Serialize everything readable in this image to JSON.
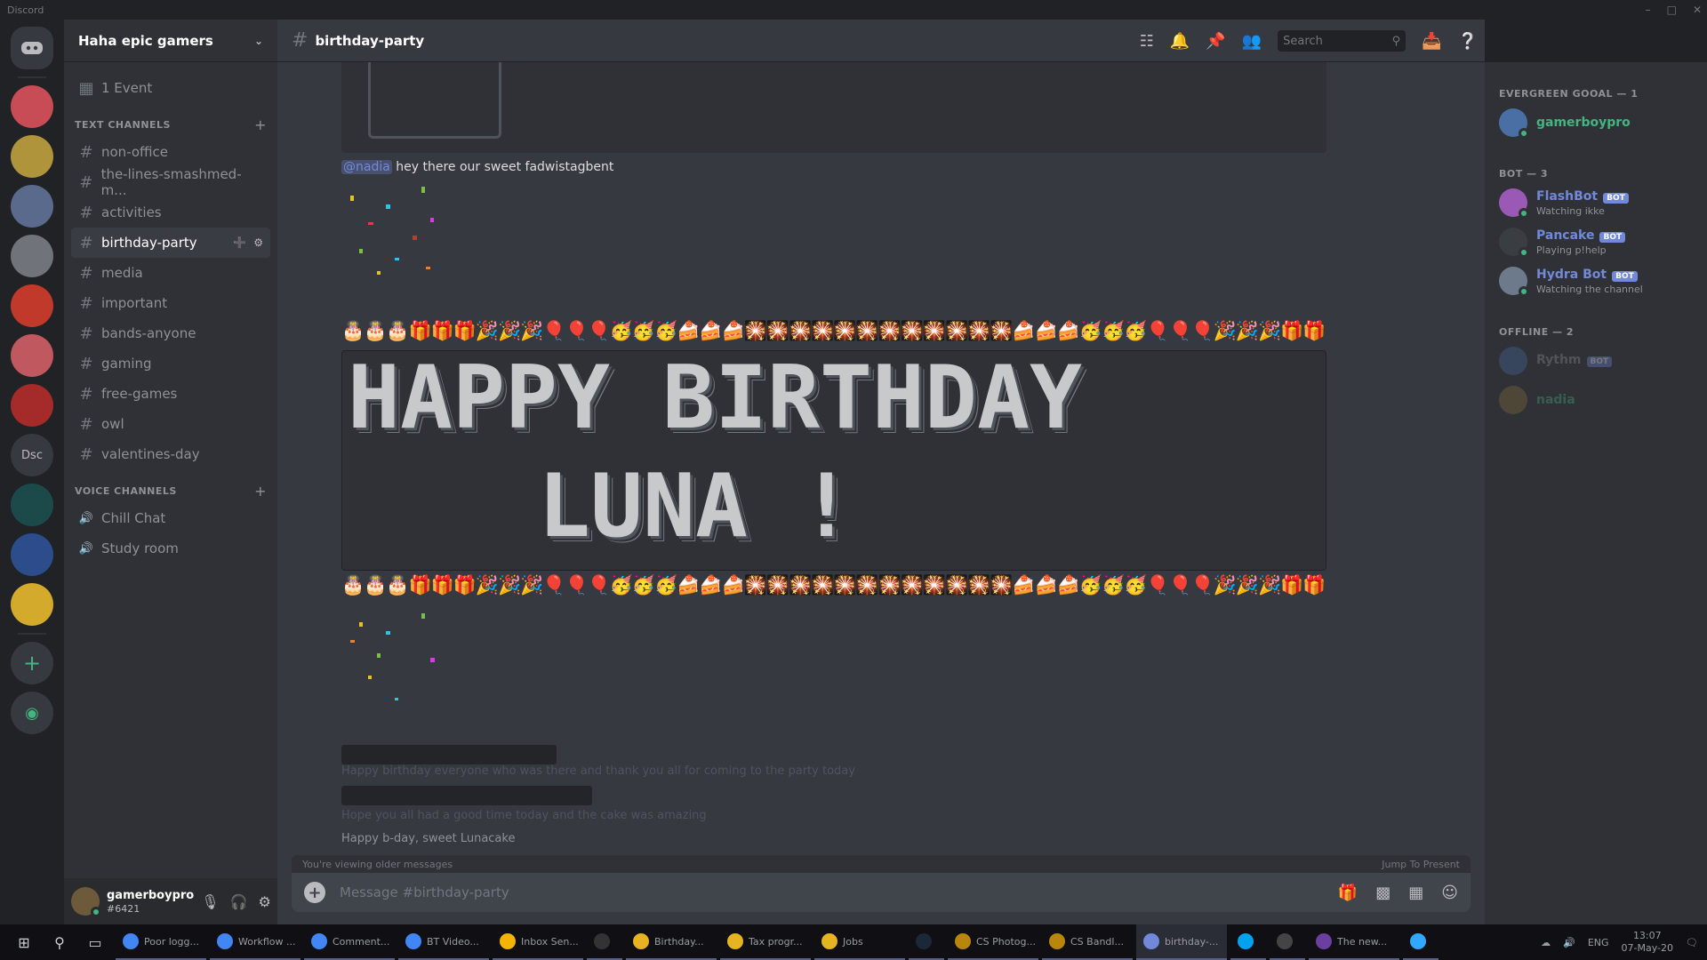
{
  "window": {
    "title": "Discord"
  },
  "servers": [
    {
      "label": "",
      "color": "#c74c55"
    },
    {
      "label": "",
      "color": "#b0943c"
    },
    {
      "label": "",
      "color": "#5a6a8c"
    },
    {
      "label": "",
      "color": "#70737a"
    },
    {
      "label": "",
      "color": "#c0392b"
    },
    {
      "label": "",
      "color": "#c0595f"
    },
    {
      "label": "",
      "color": "#a52a2a"
    },
    {
      "label": "Dsc",
      "color": "#36393f"
    },
    {
      "label": "",
      "color": "#1c4a4a"
    },
    {
      "label": "",
      "color": "#2c4c8c"
    },
    {
      "label": "",
      "color": "#d4aa2c"
    }
  ],
  "guild": {
    "name": "Haha epic gamers"
  },
  "sidebar": {
    "top_item": "1 Event",
    "text_category": "TEXT CHANNELS",
    "channels": [
      {
        "name": "non-office",
        "active": false
      },
      {
        "name": "the-lines-smashmed-m...",
        "active": false
      },
      {
        "name": "activities",
        "active": false
      },
      {
        "name": "birthday-party",
        "active": true
      },
      {
        "name": "media",
        "active": false
      },
      {
        "name": "important",
        "active": false
      },
      {
        "name": "bands-anyone",
        "active": false
      },
      {
        "name": "gaming",
        "active": false
      },
      {
        "name": "free-games",
        "active": false
      },
      {
        "name": "owl",
        "active": false
      },
      {
        "name": "valentines-day",
        "active": false
      }
    ],
    "voice_category": "VOICE CHANNELS",
    "voice_channels": [
      "Chill Chat",
      "Study room"
    ]
  },
  "user": {
    "name": "gamerboypro",
    "tag": "#6421"
  },
  "chat": {
    "channel_title": "birthday-party",
    "search_placeholder": "Search",
    "message_mention": "@nadia",
    "message_text": " hey there our sweet fadwistagbent",
    "emoji_row": "🎂🎂🎂🎁🎁🎁🎉🎉🎉🎈🎈🎈🥳🥳🥳🍰🍰🍰🎇🎇🎇🎇🎇🎇🎇🎇🎇🎇🎇🎇🍰🍰🍰🥳🥳🥳🎈🎈🎈🎉🎉🎉🎁🎁🎁🎂🎂🎂",
    "big_line_1": "HAPPY BIRTHDAY",
    "big_line_2": "LUNA !",
    "faint_line_1": "Happy birthday everyone who was there and thank you all for coming to the party today",
    "faint_line_2": "Hope you all had a good time today and the cake was amazing",
    "faint_line_3": "Happy b-day, sweet Lunacake",
    "typing_text": "You're viewing older messages",
    "jump_text": "Jump To Present",
    "composer_placeholder": "Message #birthday-party"
  },
  "members": {
    "groups": [
      {
        "title": "EVERGREEN GOOAL — 1",
        "members": [
          {
            "name": "gamerboypro",
            "status": "",
            "color": "#43b581",
            "bot": false
          }
        ]
      },
      {
        "title": "BOT — 3",
        "members": [
          {
            "name": "FlashBot",
            "status": "Watching ikke",
            "color": "#7289da",
            "bot": true
          },
          {
            "name": "Pancake",
            "status": "Playing p!help",
            "color": "#7289da",
            "bot": true
          },
          {
            "name": "Hydra Bot",
            "status": "Watching the channel",
            "color": "#7289da",
            "bot": true
          }
        ]
      },
      {
        "title": "OFFLINE — 2",
        "members": [
          {
            "name": "Rythm",
            "status": "",
            "color": "#8e9297",
            "bot": true
          },
          {
            "name": "nadia",
            "status": "",
            "color": "#43b581",
            "bot": false
          }
        ]
      }
    ]
  },
  "taskbar": {
    "items": [
      {
        "label": "Poor logg...",
        "color": "#4285f4",
        "active": false
      },
      {
        "label": "Workflow ...",
        "color": "#4285f4",
        "active": false
      },
      {
        "label": "Comment...",
        "color": "#4285f4",
        "active": false
      },
      {
        "label": "BT Video...",
        "color": "#4285f4",
        "active": false
      },
      {
        "label": "Inbox Sen...",
        "color": "#f4b400",
        "active": false
      },
      {
        "label": "",
        "color": "#333333",
        "active": false
      },
      {
        "label": "Birthday...",
        "color": "#e6b422",
        "active": false
      },
      {
        "label": "Tax progr...",
        "color": "#e6b422",
        "active": false
      },
      {
        "label": "Jobs",
        "color": "#e6b422",
        "active": false
      },
      {
        "label": "",
        "color": "#1b2838",
        "active": false
      },
      {
        "label": "CS Photog...",
        "color": "#b8860b",
        "active": false
      },
      {
        "label": "CS Bandl...",
        "color": "#b8860b",
        "active": false
      },
      {
        "label": "birthday-...",
        "color": "#7289da",
        "active": true
      },
      {
        "label": "",
        "color": "#00a2ed",
        "active": false
      },
      {
        "label": "",
        "color": "#444444",
        "active": false
      },
      {
        "label": "The new...",
        "color": "#6b3fa0",
        "active": false
      },
      {
        "label": "",
        "color": "#31a8ff",
        "active": false
      }
    ],
    "lang": "ENG",
    "time": "13:07",
    "date": "07-May-20"
  }
}
